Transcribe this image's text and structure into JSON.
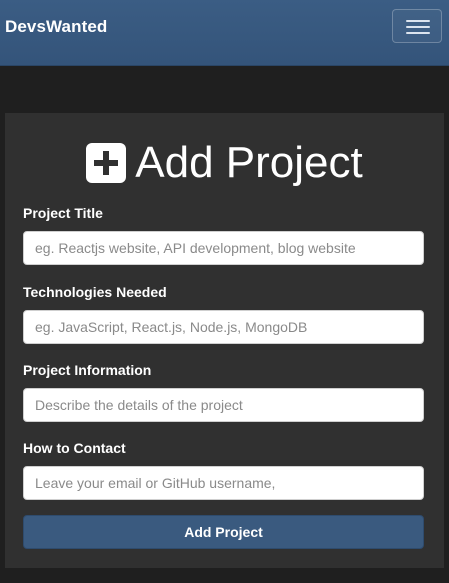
{
  "navbar": {
    "brand": "DevsWanted",
    "toggle_icon": "hamburger-menu-icon"
  },
  "form": {
    "title": "Add Project",
    "title_icon": "plus-square-icon",
    "fields": [
      {
        "label": "Project Title",
        "placeholder": "eg. Reactjs website, API development, blog website",
        "value": ""
      },
      {
        "label": "Technologies Needed",
        "placeholder": "eg. JavaScript, React.js, Node.js, MongoDB",
        "value": ""
      },
      {
        "label": "Project Information",
        "placeholder": "Describe the details of the project",
        "value": ""
      },
      {
        "label": "How to Contact",
        "placeholder": "Leave your email or GitHub username,",
        "value": ""
      }
    ],
    "submit_label": "Add Project"
  },
  "colors": {
    "navbar": "#3b5d84",
    "background": "#1f1f1f",
    "card": "#303030",
    "button": "#3a5a7f"
  }
}
